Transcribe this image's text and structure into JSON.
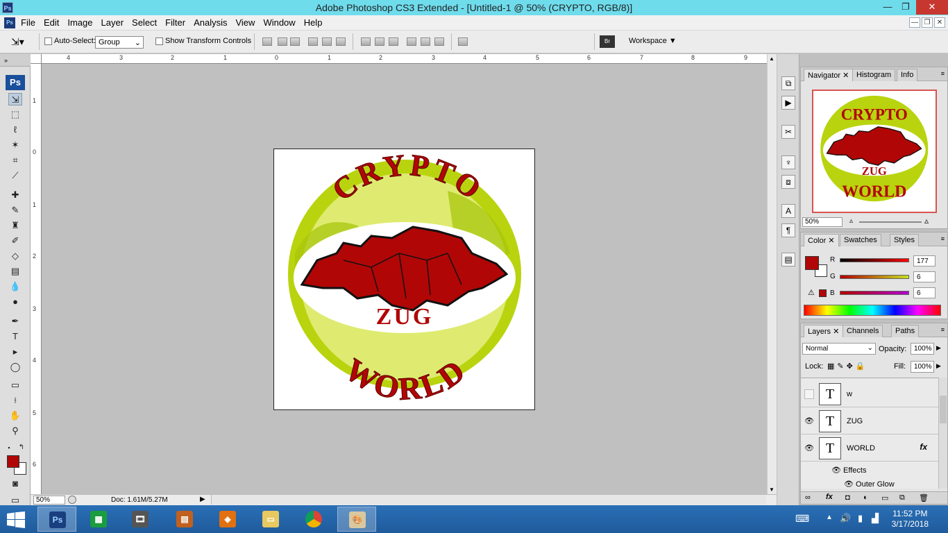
{
  "window": {
    "title": "Adobe Photoshop CS3 Extended - [Untitled-1 @ 50% (CRYPTO, RGB/8)]",
    "ps_badge": "Ps",
    "minimize_glyph": "—",
    "restore_glyph": "❐",
    "close_glyph": "✕"
  },
  "menu": [
    "File",
    "Edit",
    "Image",
    "Layer",
    "Select",
    "Filter",
    "Analysis",
    "View",
    "Window",
    "Help"
  ],
  "options": {
    "auto_select_label": "Auto-Select:",
    "auto_select_value": "Group",
    "show_transform_label": "Show Transform Controls",
    "workspace_label": "Workspace ▼"
  },
  "rulers": {
    "h_ticks": [
      "4",
      "3",
      "2",
      "1",
      "0",
      "1",
      "2",
      "3",
      "4",
      "5",
      "6",
      "7",
      "8",
      "9"
    ],
    "v_ticks": [
      "1",
      "0",
      "1",
      "2",
      "3",
      "4",
      "5",
      "6"
    ]
  },
  "status": {
    "zoom": "50%",
    "doc": "Doc: 1.61M/5.27M"
  },
  "artwork": {
    "top_text": "CRYPTO",
    "middle_text": "ZUG",
    "bottom_text": "WORLD",
    "colors": {
      "red": "#b10606",
      "green": "#b9d40e",
      "light_green": "#eef59a"
    }
  },
  "navigator": {
    "tabs": [
      "Navigator",
      "Histogram",
      "Info"
    ],
    "zoom": "50%"
  },
  "color_panel": {
    "tabs": [
      "Color",
      "Swatches",
      "Styles"
    ],
    "r_label": "R",
    "g_label": "G",
    "b_label": "B",
    "r": "177",
    "g": "6",
    "b": "6",
    "fg_color": "#b10606"
  },
  "layers_panel": {
    "tabs": [
      "Layers",
      "Channels",
      "Paths"
    ],
    "blend_mode": "Normal",
    "opacity_label": "Opacity:",
    "opacity": "100%",
    "lock_label": "Lock:",
    "fill_label": "Fill:",
    "fill": "100%",
    "layers": [
      {
        "name": "w",
        "thumb": "T",
        "visible": false
      },
      {
        "name": "ZUG",
        "thumb": "T",
        "visible": true
      },
      {
        "name": "WORLD",
        "thumb": "T",
        "visible": true,
        "fx": "fx"
      }
    ],
    "effects_label": "Effects",
    "outer_glow_label": "Outer Glow"
  },
  "taskbar": {
    "ps_label": "Ps",
    "time": "11:52 PM",
    "date": "3/17/2018"
  }
}
